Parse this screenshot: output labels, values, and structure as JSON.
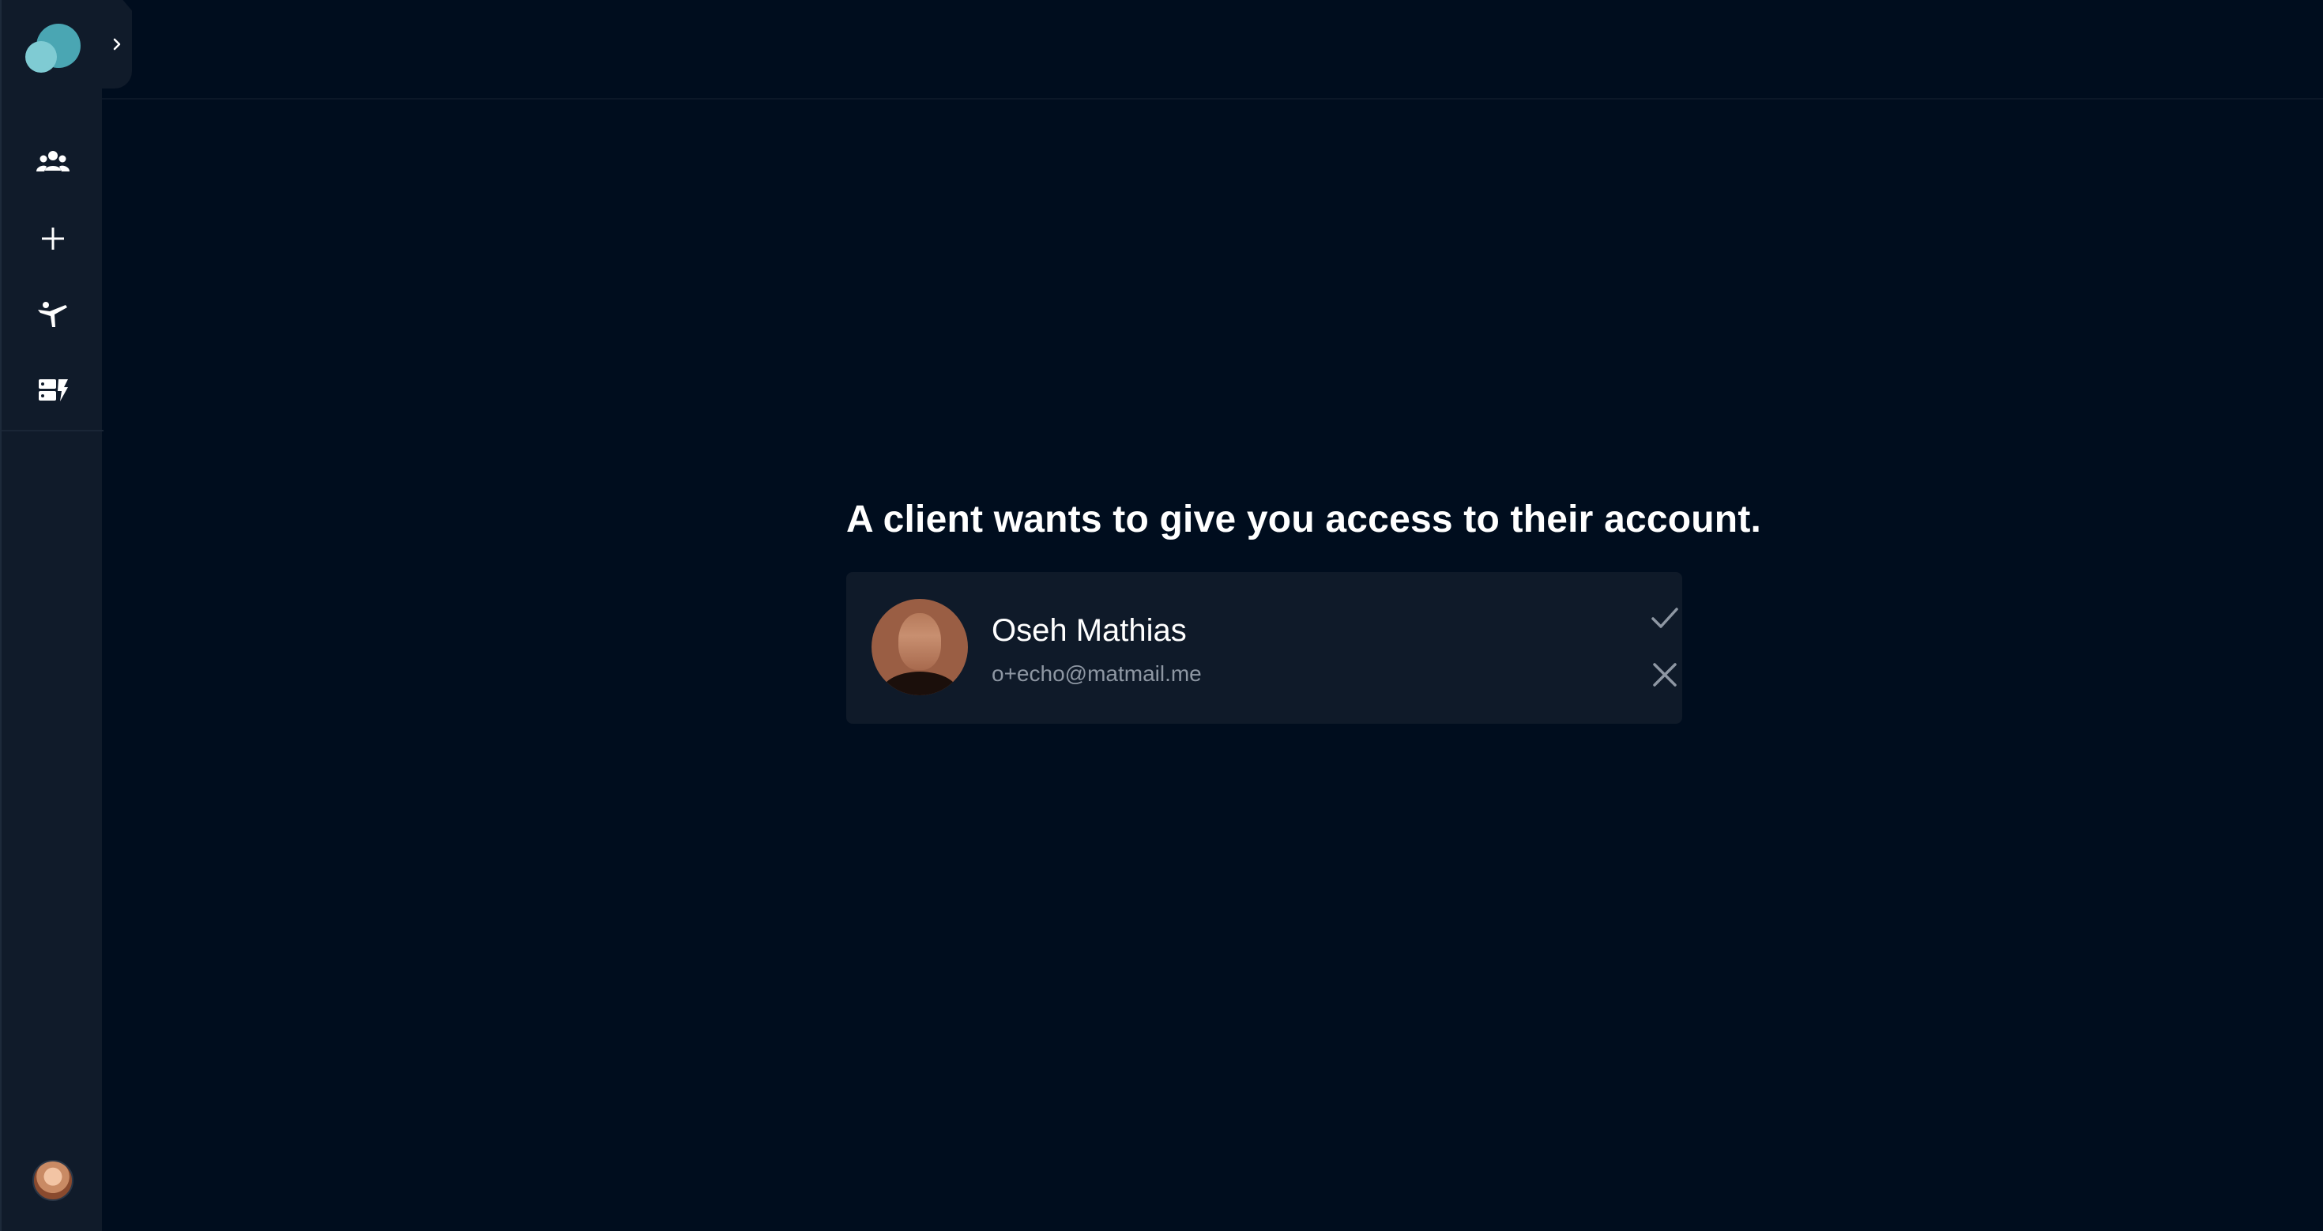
{
  "sidebar": {
    "logo_icon": "bubbles-logo-icon",
    "expand_icon": "chevron-right-icon",
    "nav_items": [
      {
        "name": "clients",
        "icon": "group-icon"
      },
      {
        "name": "add",
        "icon": "plus-icon"
      },
      {
        "name": "exercises",
        "icon": "yoga-pose-icon"
      },
      {
        "name": "programs",
        "icon": "workout-cards-icon"
      }
    ],
    "user_avatar_icon": "user-avatar"
  },
  "access_request": {
    "prompt": "A client wants to give you access to their account.",
    "client": {
      "name": "Oseh Mathias",
      "email": "o+echo@matmail.me"
    },
    "accept_icon": "check-icon",
    "decline_icon": "close-icon"
  },
  "colors": {
    "background": "#000d1e",
    "sidebar": "#101b2a",
    "card": "#0f1a29",
    "accent": "#4aa6b3",
    "muted_text": "#8e97a3"
  }
}
